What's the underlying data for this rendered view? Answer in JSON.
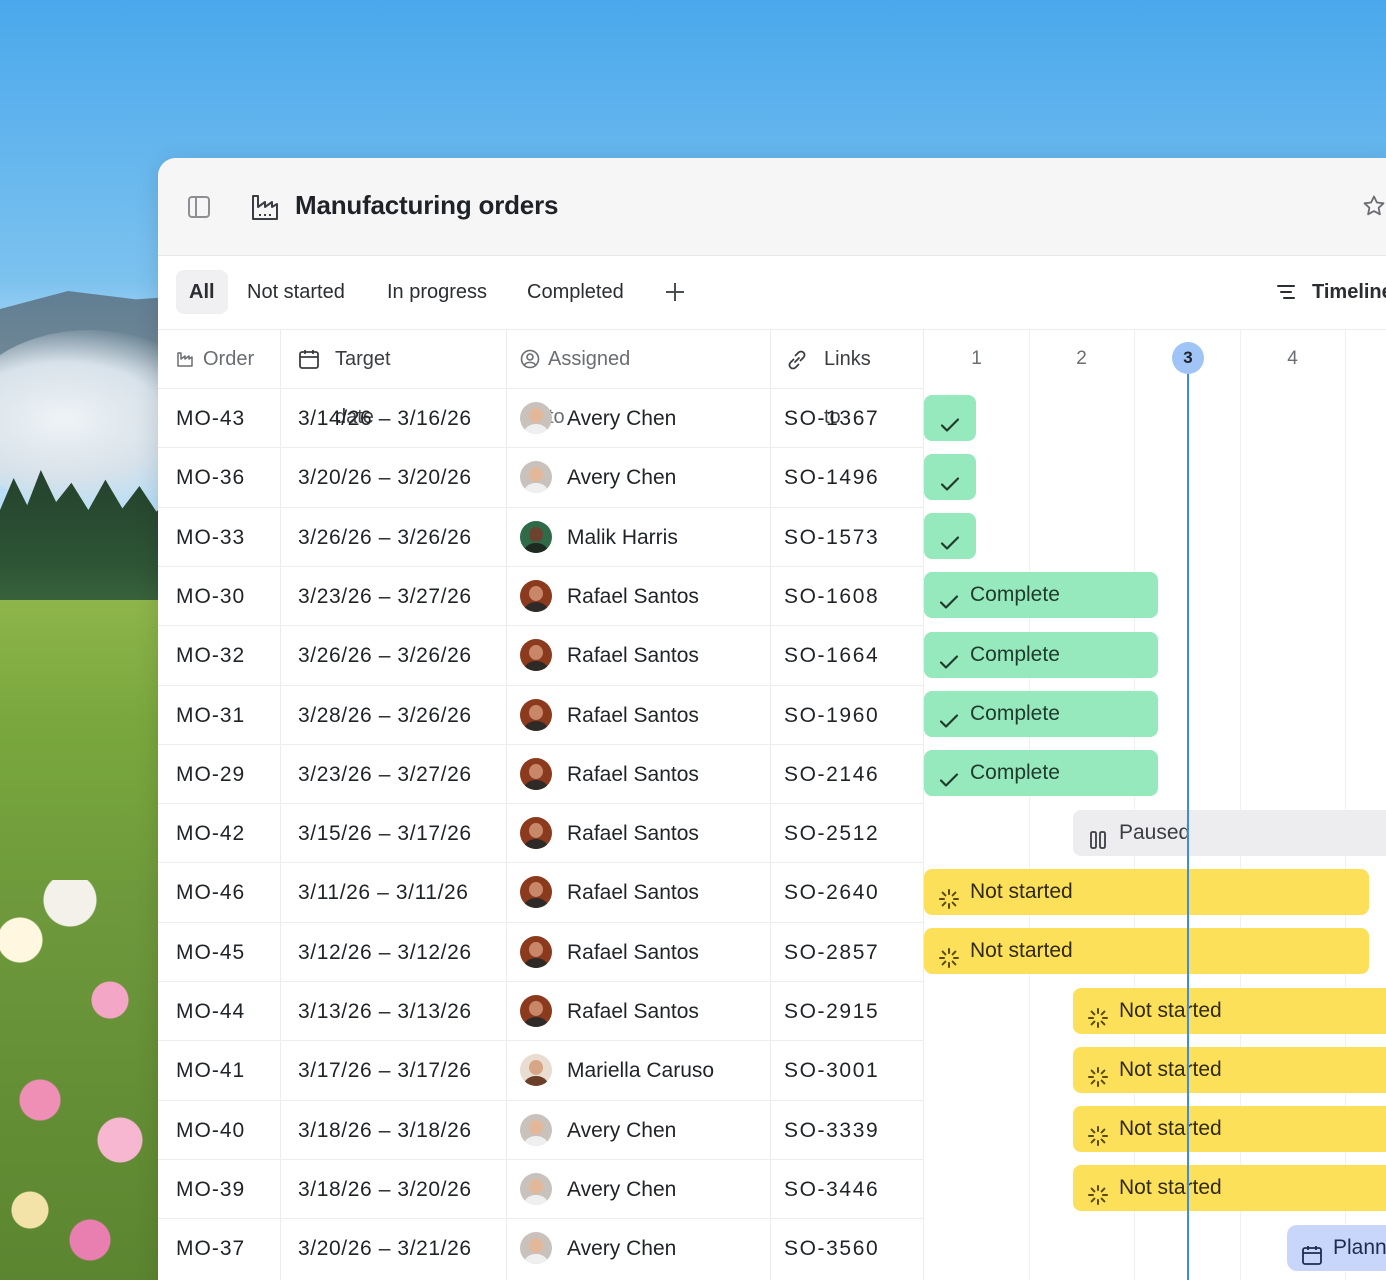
{
  "window": {
    "title": "Manufacturing orders"
  },
  "tabs": {
    "items": [
      "All",
      "Not started",
      "In progress",
      "Completed"
    ],
    "view_label": "Timeline"
  },
  "columns": {
    "order": "Order",
    "target_date": "Target date",
    "assigned_to": "Assigned to",
    "links_to": "Links to"
  },
  "timeline": {
    "days": [
      "1",
      "2",
      "3",
      "4"
    ],
    "today": "3"
  },
  "rows": [
    {
      "order": "MO-43",
      "date": "3/14/26 – 3/16/26",
      "assignee": "Avery Chen",
      "link": "SO-1367",
      "status": ""
    },
    {
      "order": "MO-36",
      "date": "3/20/26 – 3/20/26",
      "assignee": "Avery Chen",
      "link": "SO-1496",
      "status": ""
    },
    {
      "order": "MO-33",
      "date": "3/26/26 – 3/26/26",
      "assignee": "Malik Harris",
      "link": "SO-1573",
      "status": ""
    },
    {
      "order": "MO-30",
      "date": "3/23/26 – 3/27/26",
      "assignee": "Rafael Santos",
      "link": "SO-1608",
      "status": "Complete"
    },
    {
      "order": "MO-32",
      "date": "3/26/26 – 3/26/26",
      "assignee": "Rafael Santos",
      "link": "SO-1664",
      "status": "Complete"
    },
    {
      "order": "MO-31",
      "date": "3/28/26 – 3/26/26",
      "assignee": "Rafael Santos",
      "link": "SO-1960",
      "status": "Complete"
    },
    {
      "order": "MO-29",
      "date": "3/23/26 – 3/27/26",
      "assignee": "Rafael Santos",
      "link": "SO-2146",
      "status": "Complete"
    },
    {
      "order": "MO-42",
      "date": "3/15/26 – 3/17/26",
      "assignee": "Rafael Santos",
      "link": "SO-2512",
      "status": "Paused"
    },
    {
      "order": "MO-46",
      "date": "3/11/26 – 3/11/26",
      "assignee": "Rafael Santos",
      "link": "SO-2640",
      "status": "Not started"
    },
    {
      "order": "MO-45",
      "date": "3/12/26 – 3/12/26",
      "assignee": "Rafael Santos",
      "link": "SO-2857",
      "status": "Not started"
    },
    {
      "order": "MO-44",
      "date": "3/13/26 – 3/13/26",
      "assignee": "Rafael Santos",
      "link": "SO-2915",
      "status": "Not started"
    },
    {
      "order": "MO-41",
      "date": "3/17/26 – 3/17/26",
      "assignee": "Mariella Caruso",
      "link": "SO-3001",
      "status": "Not started"
    },
    {
      "order": "MO-40",
      "date": "3/18/26 – 3/18/26",
      "assignee": "Avery Chen",
      "link": "SO-3339",
      "status": "Not started"
    },
    {
      "order": "MO-39",
      "date": "3/18/26 – 3/20/26",
      "assignee": "Avery Chen",
      "link": "SO-3446",
      "status": "Not started"
    },
    {
      "order": "MO-37",
      "date": "3/20/26 – 3/21/26",
      "assignee": "Avery Chen",
      "link": "SO-3560",
      "status": "Plann"
    }
  ],
  "colors": {
    "complete": "#96e8bd",
    "not_started": "#fde05a",
    "paused": "#ededef",
    "planned": "#c8d6fb",
    "today": "#3d8be8"
  },
  "icons": {
    "sidebar": "sidebar-toggle-icon",
    "page": "factory-icon",
    "favorite": "star-icon",
    "complete": "check-icon",
    "not_started": "sparkle-dashed-icon",
    "paused": "pause-icon",
    "planned": "calendar-icon"
  }
}
